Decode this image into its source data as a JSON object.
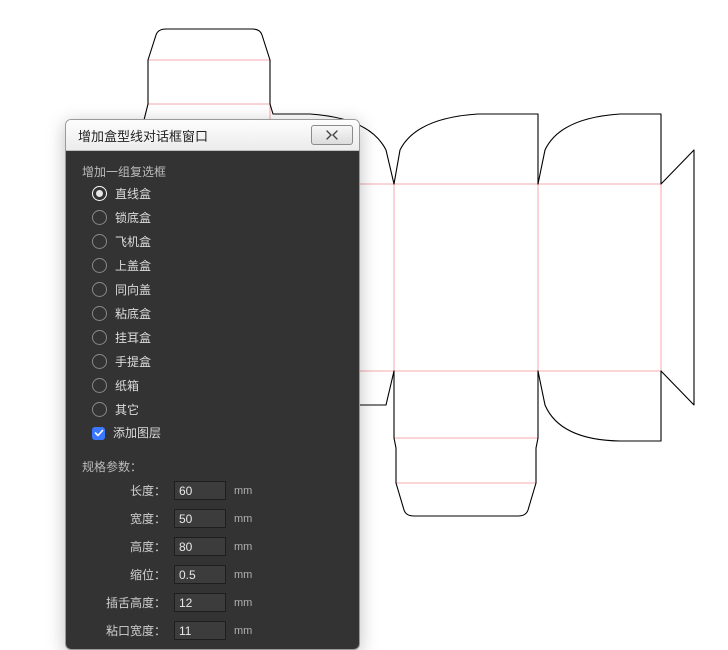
{
  "dialog": {
    "title": "增加盒型线对话框窗口",
    "group_label": "增加一组复选框",
    "options": [
      {
        "label": "直线盒",
        "selected": true
      },
      {
        "label": "锁底盒",
        "selected": false
      },
      {
        "label": "飞机盒",
        "selected": false
      },
      {
        "label": "上盖盒",
        "selected": false
      },
      {
        "label": "同向盖",
        "selected": false
      },
      {
        "label": "粘底盒",
        "selected": false
      },
      {
        "label": "挂耳盒",
        "selected": false
      },
      {
        "label": "手提盒",
        "selected": false
      },
      {
        "label": "纸箱",
        "selected": false
      },
      {
        "label": "其它",
        "selected": false
      }
    ],
    "add_layer_label": "添加图层",
    "add_layer_checked": true,
    "spec_header": "规格参数：",
    "specs": [
      {
        "label": "长度",
        "value": "60",
        "unit": "mm"
      },
      {
        "label": "宽度",
        "value": "50",
        "unit": "mm"
      },
      {
        "label": "高度",
        "value": "80",
        "unit": "mm"
      },
      {
        "label": "缩位",
        "value": "0.5",
        "unit": "mm"
      },
      {
        "label": "插舌高度",
        "value": "12",
        "unit": "mm"
      },
      {
        "label": "粘口宽度",
        "value": "11",
        "unit": "mm"
      }
    ]
  },
  "dieline": {
    "description": "straight-tuck-box unfolded dieline",
    "cut_color": "#000000",
    "fold_color": "#f8b9bc"
  }
}
